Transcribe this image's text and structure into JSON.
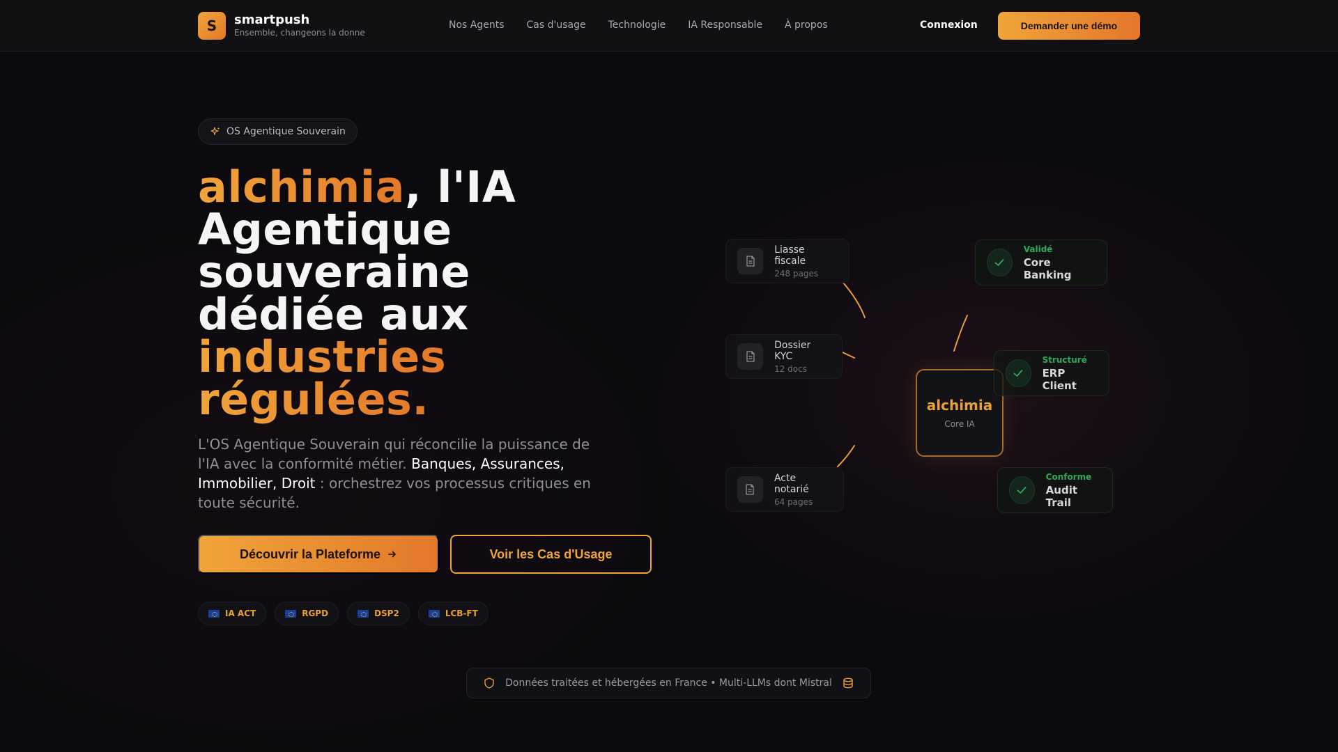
{
  "colors": {
    "accent": "#f0a43a",
    "accent_end": "#e3782a",
    "success": "#2fa85a",
    "background": "#0c0a0e"
  },
  "nav": {
    "logo_letter": "S",
    "brand_name": "smartpush",
    "brand_tagline": "Ensemble, changeons la donne",
    "links": [
      "Nos Agents",
      "Cas d'usage",
      "Technologie",
      "IA Responsable",
      "À propos"
    ],
    "login_label": "Connexion",
    "demo_label": "Demander une démo"
  },
  "hero": {
    "badge_icon": "sparkles-icon",
    "badge_label": "OS Agentique Souverain",
    "title": {
      "accent_1": "alchimia",
      "part_1": ", l'IA",
      "part_2": "Agentique",
      "part_3": "souveraine",
      "part_4": "dédiée aux",
      "accent_2": "industries",
      "accent_3": "régulées."
    },
    "lead": {
      "text_1": "L'OS Agentique Souverain qui réconcilie la puissance de l'IA avec la conformité métier. ",
      "highlight": "Banques, Assurances, Immobilier, Droit",
      "text_2": " : orchestrez vos processus critiques en toute sécurité."
    },
    "primary_cta": "Découvrir la Plateforme",
    "primary_cta_icon": "arrow-right-icon",
    "secondary_cta": "Voir les Cas d'Usage",
    "compliance": [
      "IA ACT",
      "RGPD",
      "DSP2",
      "LCB-FT"
    ]
  },
  "diagram": {
    "inputs": [
      {
        "title": "Liasse fiscale",
        "subtitle": "248 pages"
      },
      {
        "title": "Dossier KYC",
        "subtitle": "12 docs"
      },
      {
        "title": "Acte notarié",
        "subtitle": "64 pages"
      }
    ],
    "core": {
      "name": "alchimia",
      "subtitle": "Core IA"
    },
    "outputs": [
      {
        "status": "Validé",
        "title": "Core Banking"
      },
      {
        "status": "Structuré",
        "title": "ERP Client"
      },
      {
        "status": "Conforme",
        "title": "Audit Trail"
      }
    ]
  },
  "footer": {
    "shield_icon": "shield-icon",
    "text": "Données traitées et hébergées en France • Multi-LLMs dont Mistral",
    "database_icon": "database-icon"
  }
}
